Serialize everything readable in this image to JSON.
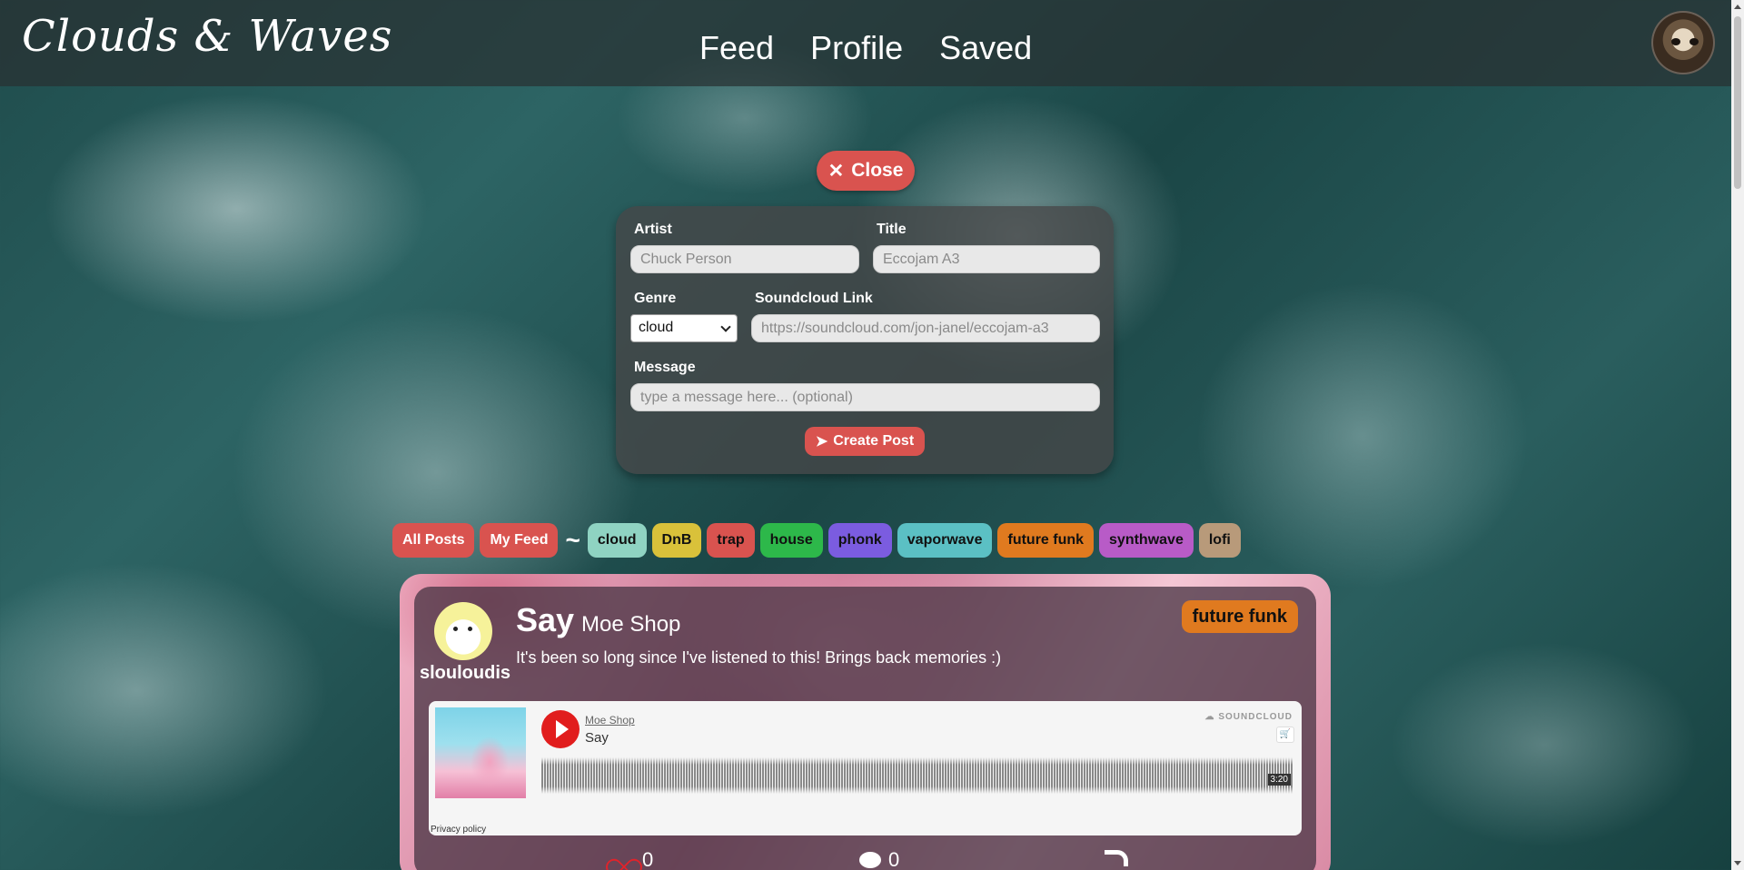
{
  "header": {
    "brand": "Clouds & Waves",
    "nav": [
      "Feed",
      "Profile",
      "Saved"
    ]
  },
  "form": {
    "close_label": "Close",
    "artist_label": "Artist",
    "artist_placeholder": "Chuck Person",
    "title_label": "Title",
    "title_placeholder": "Eccojam A3",
    "genre_label": "Genre",
    "genre_selected": "cloud",
    "link_label": "Soundcloud Link",
    "link_placeholder": "https://soundcloud.com/jon-janel/eccojam-a3",
    "message_label": "Message",
    "message_placeholder": "type a message here... (optional)",
    "create_label": "Create Post"
  },
  "filters": {
    "all_posts": "All Posts",
    "my_feed": "My Feed",
    "separator": "~",
    "genres": [
      {
        "label": "cloud",
        "color": "#8fd3c2"
      },
      {
        "label": "DnB",
        "color": "#d9c13a"
      },
      {
        "label": "trap",
        "color": "#d9534f"
      },
      {
        "label": "house",
        "color": "#2db84a"
      },
      {
        "label": "phonk",
        "color": "#7b5ce0"
      },
      {
        "label": "vaporwave",
        "color": "#5bc0c4"
      },
      {
        "label": "future funk",
        "color": "#e07a1f"
      },
      {
        "label": "synthwave",
        "color": "#b85bc7"
      },
      {
        "label": "lofi",
        "color": "#b89a7a"
      }
    ]
  },
  "post": {
    "username": "slouloudis",
    "title": "Say",
    "artist": "Moe Shop",
    "message": "It's been so long since I've listened to this! Brings back memories :)",
    "genre": "future funk",
    "embed": {
      "artist": "Moe Shop",
      "track": "Say",
      "brand": "SOUNDCLOUD",
      "duration": "3:20",
      "privacy": "Privacy policy"
    },
    "likes": "0",
    "comments": "0"
  }
}
